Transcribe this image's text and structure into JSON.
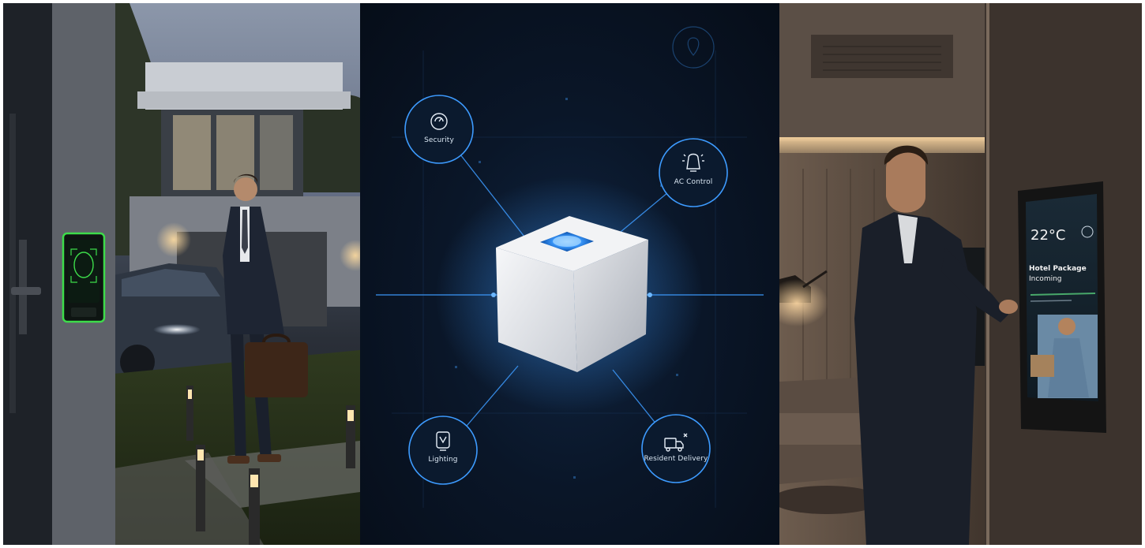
{
  "center_panel": {
    "nodes": [
      {
        "label": "Security",
        "icon": "gauge-icon"
      },
      {
        "label": "AC Control",
        "icon": "ac-unit-icon"
      },
      {
        "label": "Lighting",
        "icon": "lighting-icon"
      },
      {
        "label": "Resident Delivery",
        "icon": "delivery-icon"
      }
    ],
    "top_icon": "location-pin-icon",
    "hub": "smart-home-hub-cube",
    "accent_color": "#3d9bff"
  },
  "right_panel": {
    "tablet": {
      "temperature": "22°C",
      "notice_title": "Hotel Package",
      "notice_subtitle": "Incoming"
    }
  },
  "left_panel": {
    "access_panel_color": "#3ddc4a"
  }
}
